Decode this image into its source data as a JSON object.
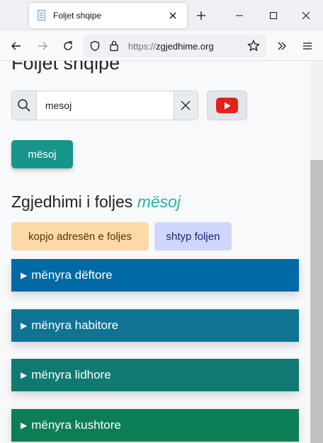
{
  "browser": {
    "tab_title": "Foljet shqipe",
    "url_scheme": "https://",
    "url_host": "zgjedhime.org"
  },
  "page": {
    "title": "Foljet shqipe",
    "search_value": "mesoj",
    "primary_button": "mësoj",
    "heading_prefix": "Zgjedhimi i foljes",
    "heading_verb": "mësoj",
    "copy_button": "kopjo adresën e foljes",
    "print_button": "shtyp foljen",
    "moods": [
      {
        "label": "mënyra dëftore",
        "color": "#0069a6"
      },
      {
        "label": "mënyra habitore",
        "color": "#0f7493"
      },
      {
        "label": "mënyra lidhore",
        "color": "#107a72"
      },
      {
        "label": "mënyra kushtore",
        "color": "#0c7e55"
      }
    ]
  },
  "colors": {
    "accent": "#17958a",
    "verb": "#1fb5a6"
  }
}
